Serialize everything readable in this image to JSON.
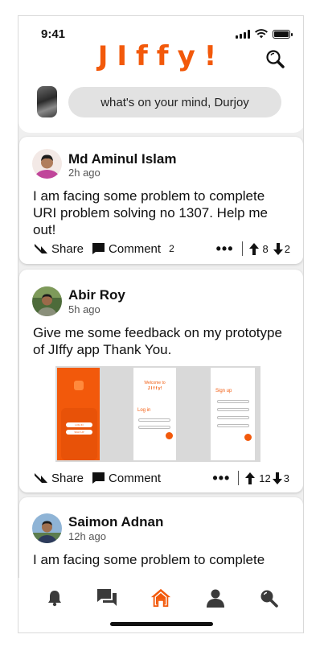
{
  "status": {
    "time": "9:41"
  },
  "app": {
    "title": "JIffy!"
  },
  "colors": {
    "brand": "#f2590b",
    "icon": "#3a3a3a"
  },
  "composer": {
    "placeholder": "what's on your mind, Durjoy"
  },
  "posts": [
    {
      "author": "Md Aminul Islam",
      "time": "2h ago",
      "text": "I am facing some problem to complete URI problem solving no 1307. Help me out!",
      "share_label": "Share",
      "comment_label": "Comment",
      "comment_count": "2",
      "more": "•••",
      "upvotes": "8",
      "downvotes": "2"
    },
    {
      "author": "Abir Roy",
      "time": "5h ago",
      "text": "Give me some feedback on my prototype of JIffy app Thank You.",
      "share_label": "Share",
      "comment_label": "Comment",
      "more": "•••",
      "upvotes": "12",
      "downvotes": "3",
      "preview": {
        "welcome": "Welcome to",
        "app": "J I f f y!",
        "login_title": "Log in",
        "signup_title": "Sign up",
        "login_btn": "LOG IN",
        "signup_btn": "SIGN UP"
      }
    },
    {
      "author": "Saimon Adnan",
      "time": "12h ago",
      "text": "I am facing some problem to complete"
    }
  ],
  "nav": {
    "items": [
      "notifications-icon",
      "messages-icon",
      "home-icon",
      "profile-icon",
      "search-icon"
    ],
    "active": "home-icon"
  }
}
